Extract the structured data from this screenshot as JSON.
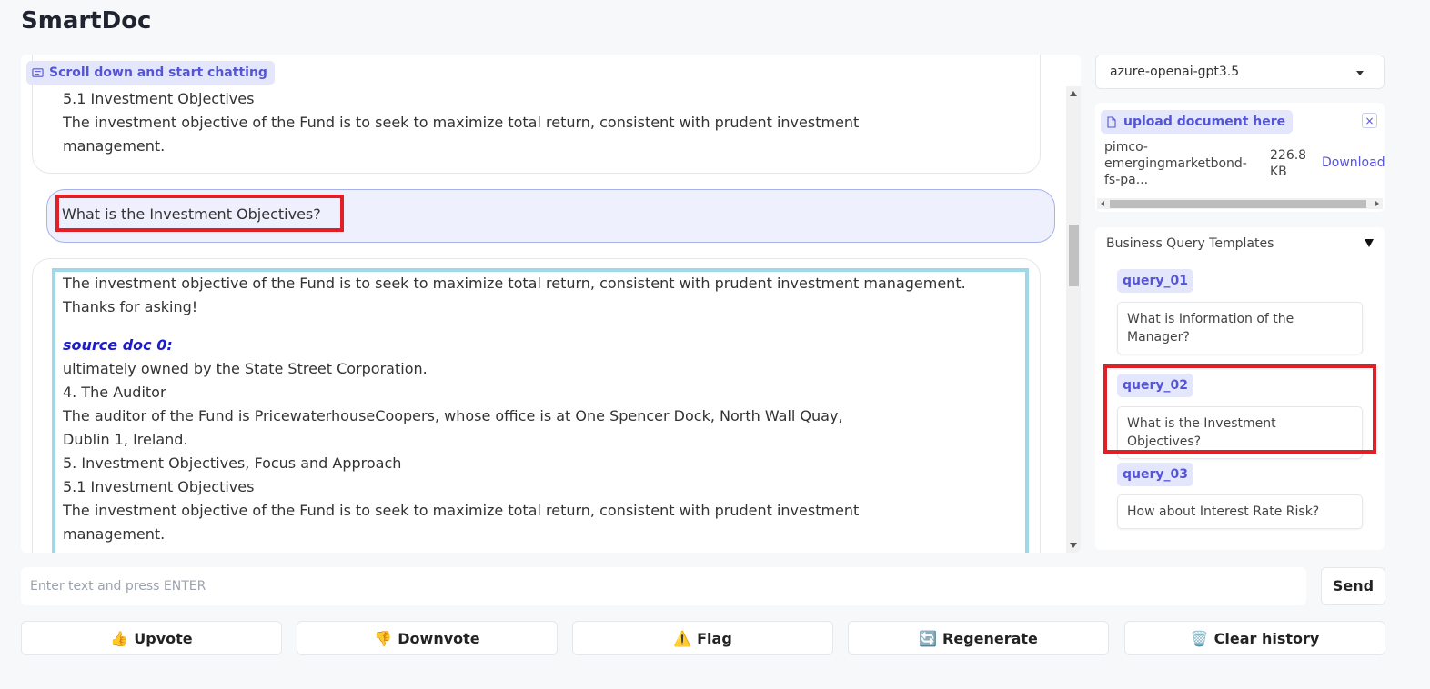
{
  "app": {
    "title": "SmartDoc"
  },
  "chat": {
    "label": "Scroll down and start chatting",
    "previous_bot": {
      "lines": [
        "5.1 Investment Objectives",
        "The investment objective of the Fund is to seek to maximize total return, consistent with prudent investment",
        "management."
      ]
    },
    "user_message": "What is the Investment Objectives?",
    "bot_answer": {
      "text": "The investment objective of the Fund is to seek to maximize total return, consistent with prudent investment management. Thanks for asking!",
      "source_heading": "source doc 0:",
      "source_lines": [
        "ultimately owned by the State Street Corporation.",
        "4. The Auditor",
        "The auditor of the Fund is PricewaterhouseCoopers, whose office is at One Spencer Dock, North Wall Quay,",
        "Dublin 1, Ireland.",
        "5. Investment Objectives, Focus and Approach",
        "5.1 Investment Objectives",
        "The investment objective of the Fund is to seek to maximize total return, consistent with prudent investment",
        "management."
      ]
    }
  },
  "model": {
    "selected": "azure-openai-gpt3.5"
  },
  "upload": {
    "label": "upload document here",
    "close": "×",
    "file": {
      "name": "pimco-emergingmarketbond-fs-pa...",
      "size": "226.8 KB",
      "download": "Download"
    }
  },
  "templates": {
    "title": "Business Query Templates",
    "items": [
      {
        "label": "query_01",
        "text": "What is Information of the Manager?"
      },
      {
        "label": "query_02",
        "text": "What is the Investment Objectives?"
      },
      {
        "label": "query_03",
        "text": "How about Interest Rate Risk?"
      }
    ]
  },
  "input": {
    "placeholder": "Enter text and press ENTER",
    "send": "Send"
  },
  "actions": [
    {
      "label": "Upvote",
      "icon": "👍"
    },
    {
      "label": "Downvote",
      "icon": "👎"
    },
    {
      "label": "Flag",
      "icon": "⚠️"
    },
    {
      "label": "Regenerate",
      "icon": "🔄"
    },
    {
      "label": "Clear history",
      "icon": "🗑️"
    }
  ]
}
